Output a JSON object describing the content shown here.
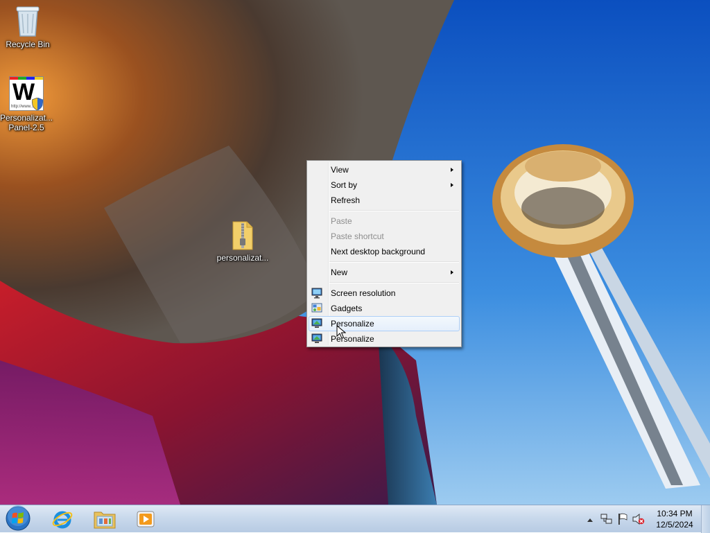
{
  "desktop": {
    "icons": [
      {
        "label": "Recycle Bin",
        "icon": "recycle-bin-icon"
      },
      {
        "label": "Personalizat...\nPanel-2.5",
        "icon": "personalization-panel-icon",
        "badge": "W",
        "caption": "http://www..."
      },
      {
        "label": "personalizat...",
        "icon": "zip-folder-icon"
      }
    ]
  },
  "context_menu": {
    "items": [
      {
        "label": "View",
        "submenu": true
      },
      {
        "label": "Sort by",
        "submenu": true
      },
      {
        "label": "Refresh"
      },
      {
        "label": "Paste",
        "disabled": true
      },
      {
        "label": "Paste shortcut",
        "disabled": true
      },
      {
        "label": "Next desktop background"
      },
      {
        "label": "New",
        "submenu": true
      },
      {
        "label": "Screen resolution",
        "icon": "monitor-icon"
      },
      {
        "label": "Gadgets",
        "icon": "gadgets-icon"
      },
      {
        "label": "Personalize",
        "icon": "personalize-icon",
        "highlighted": true
      },
      {
        "label": "Personalize",
        "icon": "personalize-icon"
      }
    ]
  },
  "taskbar": {
    "pinned": [
      {
        "name": "start-button",
        "icon": "windows-logo-icon"
      },
      {
        "name": "internet-explorer-button",
        "icon": "internet-explorer-icon"
      },
      {
        "name": "windows-explorer-button",
        "icon": "folder-library-icon"
      },
      {
        "name": "media-player-button",
        "icon": "media-player-icon"
      }
    ],
    "tray_icons": [
      "show-hidden-icons-arrow",
      "network-icon",
      "action-center-flag-icon",
      "volume-muted-icon"
    ],
    "clock": {
      "time": "10:34 PM",
      "date": "12/5/2024"
    }
  },
  "colors": {
    "menu_background": "#f0f0f0",
    "menu_highlight_border": "#aecff7",
    "taskbar_top": "#dfe9f5",
    "sky_blue": "#1f6fd0"
  }
}
